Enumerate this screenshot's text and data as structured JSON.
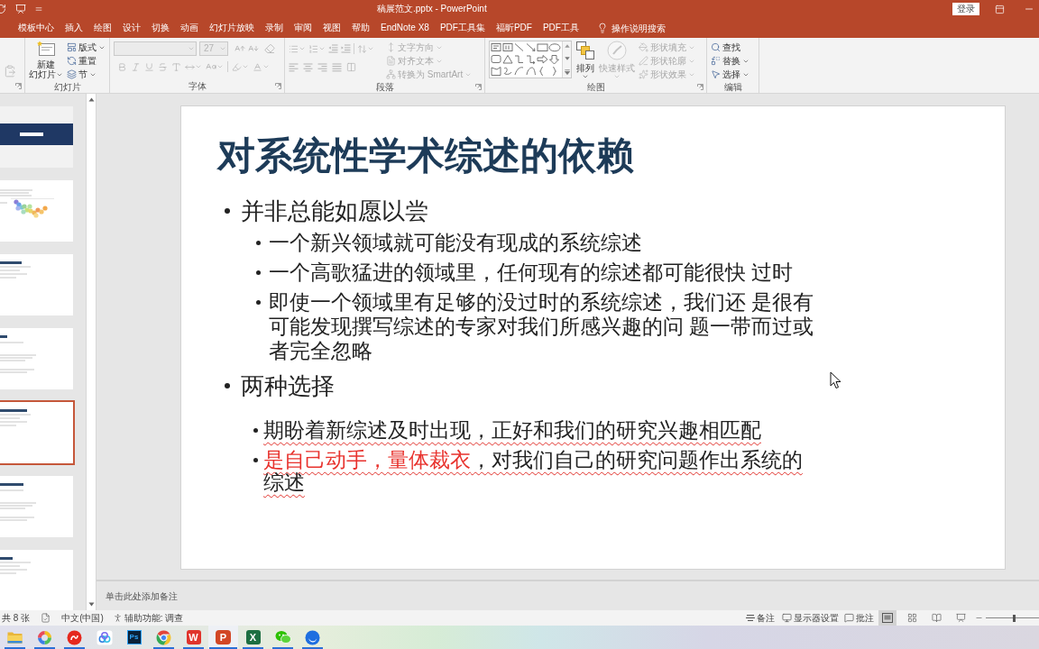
{
  "title_bar": {
    "title": "稿展范文.pptx - PowerPoint",
    "sign_in": "登录"
  },
  "tabs": [
    {
      "label": "模板中心",
      "selected": false
    },
    {
      "label": "插入",
      "selected": false
    },
    {
      "label": "绘图",
      "selected": false
    },
    {
      "label": "设计",
      "selected": false
    },
    {
      "label": "切换",
      "selected": false
    },
    {
      "label": "动画",
      "selected": false
    },
    {
      "label": "幻灯片放映",
      "selected": false
    },
    {
      "label": "录制",
      "selected": false
    },
    {
      "label": "审阅",
      "selected": false
    },
    {
      "label": "视图",
      "selected": false
    },
    {
      "label": "帮助",
      "selected": false
    },
    {
      "label": "EndNote X8",
      "selected": false
    },
    {
      "label": "PDF工具集",
      "selected": false
    },
    {
      "label": "福昕PDF",
      "selected": false
    },
    {
      "label": "PDF工具",
      "selected": false
    }
  ],
  "tell_me": {
    "placeholder": "操作说明搜索"
  },
  "ribbon": {
    "slides": {
      "label": "幻灯片",
      "new_slide": {
        "lines": [
          "新建",
          "幻灯片"
        ]
      },
      "commands": [
        {
          "label": "版式",
          "dropdown": true,
          "disabled": false
        },
        {
          "label": "重置",
          "dropdown": false,
          "disabled": false
        },
        {
          "label": "节",
          "dropdown": true,
          "disabled": false
        }
      ]
    },
    "font": {
      "label": "字体",
      "font_size": "27"
    },
    "paragraph": {
      "label": "段落",
      "commands": [
        {
          "label": "文字方向",
          "dropdown": true,
          "disabled": true
        },
        {
          "label": "对齐文本",
          "dropdown": true,
          "disabled": true
        },
        {
          "label": "转换为 SmartArt",
          "dropdown": true,
          "disabled": true
        }
      ]
    },
    "drawing": {
      "label": "绘图",
      "large": [
        {
          "label": "排列",
          "disabled": false
        },
        {
          "label": "快速样式",
          "disabled": true
        }
      ],
      "commands": [
        {
          "label": "形状填充",
          "dropdown": true,
          "disabled": true
        },
        {
          "label": "形状轮廓",
          "dropdown": true,
          "disabled": true
        },
        {
          "label": "形状效果",
          "dropdown": true,
          "disabled": true
        }
      ]
    },
    "editing": {
      "label": "编辑",
      "commands": [
        {
          "label": "查找",
          "dropdown": false,
          "disabled": false
        },
        {
          "label": "替换",
          "dropdown": true,
          "disabled": false
        },
        {
          "label": "选择",
          "dropdown": true,
          "disabled": false
        }
      ]
    }
  },
  "thumbnails": [
    {
      "kind": "title",
      "selected": false
    },
    {
      "kind": "figure",
      "selected": false
    },
    {
      "kind": "text",
      "selected": false
    },
    {
      "kind": "text",
      "selected": false
    },
    {
      "kind": "text",
      "selected": true
    },
    {
      "kind": "text",
      "selected": false
    },
    {
      "kind": "text",
      "selected": false
    }
  ],
  "slide": {
    "title": "对系统性学术综述的依赖",
    "bullets": [
      {
        "text": "并非总能如愿以尝",
        "children": [
          {
            "runs": [
              {
                "text": "一个新兴领域就可能没有现成的系统综述",
                "emphasized": false
              }
            ],
            "flagged": false
          },
          {
            "runs": [
              {
                "text": "一个高歌猛进的领域里，任何现有的综述都可能很快 过时",
                "emphasized": false
              }
            ],
            "flagged": false
          },
          {
            "runs": [
              {
                "text": "即使一个领域里有足够的没过时的系统综述，我们还 是很有可能发现撰写综述的专家对我们所感兴趣的问 题一带而过或者完全忽略",
                "emphasized": false
              }
            ],
            "flagged": false
          }
        ]
      },
      {
        "text": "两种选择",
        "children": [
          {
            "runs": [
              {
                "text": "期盼着新综述及时出现，正好和我们的研究兴趣相匹配",
                "emphasized": false
              }
            ],
            "flagged": true
          },
          {
            "runs": [
              {
                "text": "是自己动手，量体裁衣",
                "emphasized": true
              },
              {
                "text": "，对我们自己的研究问题作出系统的综述",
                "emphasized": false
              }
            ],
            "flagged": true
          }
        ]
      }
    ]
  },
  "notes": {
    "placeholder": "单击此处添加备注"
  },
  "status_bar": {
    "slide_count": "共 8 张",
    "language": "中文(中国)",
    "accessibility": "辅助功能: 调查",
    "notes": "备注",
    "display_settings": "显示器设置",
    "comments": "批注",
    "views": [
      {
        "kind": "normal",
        "selected": true
      },
      {
        "kind": "sorter",
        "selected": false
      },
      {
        "kind": "reading",
        "selected": false
      },
      {
        "kind": "slideshow",
        "selected": false
      }
    ],
    "zoom": {
      "level": 0.53
    }
  },
  "taskbar": {
    "apps": [
      {
        "kind": "folder",
        "running": true,
        "selected": false
      },
      {
        "kind": "ring",
        "running": true,
        "selected": false
      },
      {
        "kind": "red_circle",
        "running": true,
        "selected": false
      },
      {
        "kind": "cloud",
        "running": false,
        "selected": false
      },
      {
        "kind": "ps",
        "glyph": "Ps",
        "running": false,
        "selected": false
      },
      {
        "kind": "browser",
        "running": true,
        "selected": false
      },
      {
        "kind": "wps",
        "glyph": "W",
        "running": true,
        "selected": false
      },
      {
        "kind": "powerpoint",
        "glyph": "P",
        "running": true,
        "selected": true
      },
      {
        "kind": "excel",
        "glyph": "X",
        "running": true,
        "selected": false
      },
      {
        "kind": "chat",
        "running": true,
        "selected": false
      },
      {
        "kind": "blue_circle",
        "running": true,
        "selected": false
      }
    ]
  }
}
